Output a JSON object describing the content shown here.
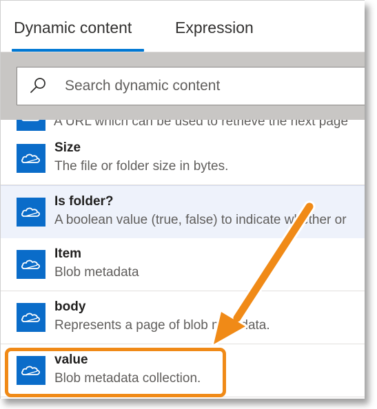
{
  "tabs": [
    {
      "label": "Dynamic content",
      "active": true
    },
    {
      "label": "Expression",
      "active": false
    }
  ],
  "search": {
    "placeholder": "Search dynamic content"
  },
  "items": [
    {
      "title": "",
      "desc": "A URL which can be used to retrieve the next page",
      "icon": "onedrive-cloud-icon",
      "partial": true
    },
    {
      "title": "Size",
      "desc": "The file or folder size in bytes.",
      "icon": "onedrive-cloud-icon"
    },
    {
      "title": "Is folder?",
      "desc": "A boolean value (true, false) to indicate whether or",
      "icon": "onedrive-cloud-icon",
      "selected": true
    },
    {
      "title": "Item",
      "desc": "Blob metadata",
      "icon": "onedrive-cloud-icon"
    },
    {
      "title": "body",
      "desc": "Represents a page of blob metadata.",
      "icon": "onedrive-cloud-icon"
    },
    {
      "title": "value",
      "desc": "Blob metadata collection.",
      "icon": "onedrive-cloud-icon",
      "highlighted": true
    }
  ],
  "colors": {
    "accent": "#0078d4",
    "icon_tile": "#0a6cc9",
    "annotation": "#f08a17",
    "selected_row": "#eef2fb",
    "search_band": "#c8c6c4"
  }
}
